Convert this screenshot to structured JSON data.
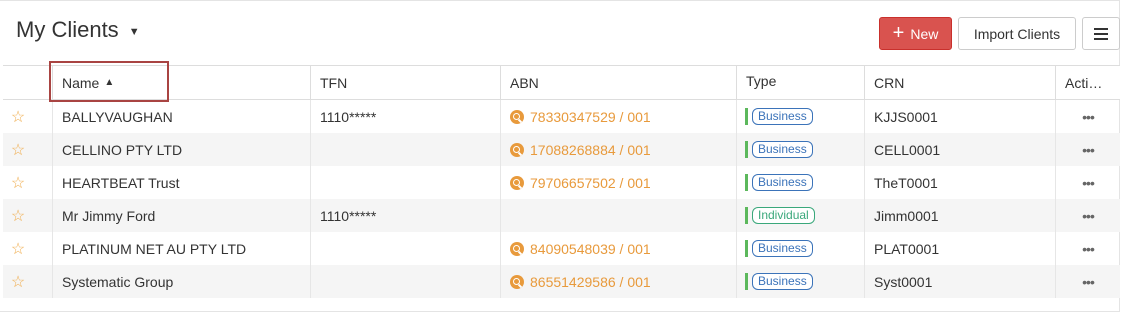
{
  "header": {
    "title": "My Clients",
    "new_label": "New",
    "import_label": "Import Clients"
  },
  "table": {
    "columns": {
      "name": "Name",
      "tfn": "TFN",
      "abn": "ABN",
      "type": "Type",
      "crn": "CRN",
      "actions": "Acti…"
    },
    "sort_indicator": "▲",
    "rows": [
      {
        "name": "BALLYVAUGHAN",
        "tfn": "1110*****",
        "abn": "78330347529 / 001",
        "type": "Business",
        "crn": "KJJS0001"
      },
      {
        "name": "CELLINO PTY LTD",
        "tfn": "",
        "abn": "17088268884 / 001",
        "type": "Business",
        "crn": "CELL0001"
      },
      {
        "name": "HEARTBEAT Trust",
        "tfn": "",
        "abn": "79706657502 / 001",
        "type": "Business",
        "crn": "TheT0001"
      },
      {
        "name": "Mr Jimmy Ford",
        "tfn": "1110*****",
        "abn": "",
        "type": "Individual",
        "crn": "Jimm0001"
      },
      {
        "name": "PLATINUM NET AU PTY LTD",
        "tfn": "",
        "abn": "84090548039 / 001",
        "type": "Business",
        "crn": "PLAT0001"
      },
      {
        "name": "Systematic Group",
        "tfn": "",
        "abn": "86551429586 / 001",
        "type": "Business",
        "crn": "Syst0001"
      }
    ]
  },
  "colors": {
    "primary_button": "#d9534f",
    "abn_link": "#e89a3c",
    "business_badge": "#3b73b9",
    "individual_badge": "#3aa87b",
    "star": "#f0ad4e"
  }
}
